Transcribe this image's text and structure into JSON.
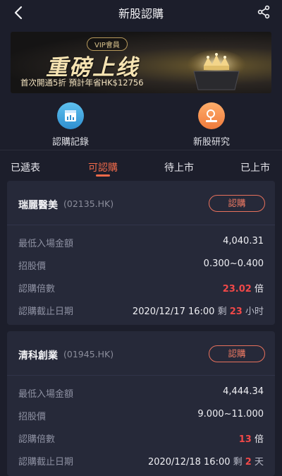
{
  "header": {
    "title": "新股認購"
  },
  "banner": {
    "vip_tag": "VIP會員",
    "headline": "重磅上线",
    "sub_text": "首次開通5折   預計年省HK$12756",
    "colors": {
      "gold": "#f6e3b2",
      "dark": "#151414"
    }
  },
  "quick_links": [
    {
      "label": "認購記錄",
      "icon": "calendar-chart-icon"
    },
    {
      "label": "新股研究",
      "icon": "research-icon"
    }
  ],
  "tabs": [
    {
      "label": "已遞表",
      "active": false
    },
    {
      "label": "可認購",
      "active": true
    },
    {
      "label": "待上市",
      "active": false
    },
    {
      "label": "已上市",
      "active": false
    }
  ],
  "accent_color": "#ef6a4a",
  "ipos": [
    {
      "name": "瑞麗醫美",
      "code": "(02135.HK)",
      "button": "認購",
      "rows": [
        {
          "label": "最低入場金額",
          "value": "4,040.31"
        },
        {
          "label": "招股價",
          "value": "0.300~0.400"
        },
        {
          "label": "認購倍數",
          "value": "23.02",
          "unit": "倍"
        },
        {
          "label": "認購截止日期",
          "date": "2020/12/17 16:00",
          "remain_prefix": "剩",
          "remain_num": "23",
          "remain_unit": "小时"
        }
      ]
    },
    {
      "name": "清科創業",
      "code": "(01945.HK)",
      "button": "認購",
      "rows": [
        {
          "label": "最低入場金額",
          "value": "4,444.34"
        },
        {
          "label": "招股價",
          "value": "9.000~11.000"
        },
        {
          "label": "認購倍數",
          "value": "13",
          "unit": "倍"
        },
        {
          "label": "認購截止日期",
          "date": "2020/12/18 16:00",
          "remain_prefix": "剩",
          "remain_num": "2",
          "remain_unit": "天"
        }
      ]
    }
  ]
}
